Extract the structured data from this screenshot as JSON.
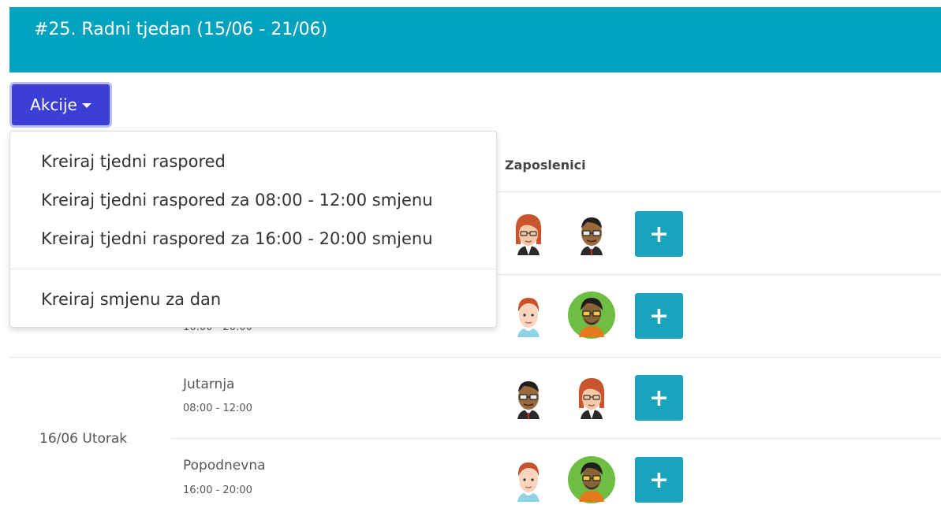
{
  "header": {
    "title": "#25. Radni tjedan (15/06 - 21/06)"
  },
  "actions": {
    "label": "Akcije"
  },
  "dropdown": {
    "items": [
      "Kreiraj tjedni raspored",
      "Kreiraj tjedni raspored za 08:00 - 12:00 smjenu",
      "Kreiraj tjedni raspored za 16:00 - 20:00 smjenu",
      "Kreiraj smjenu za dan"
    ]
  },
  "table": {
    "employees_header": "Zaposlenici",
    "add_symbol": "+",
    "partial_time": "16:00 - 20:00",
    "days": [
      {
        "label": "16/06 Utorak",
        "shifts": [
          {
            "name": "Jutarnja",
            "time": "08:00 - 12:00"
          },
          {
            "name": "Popodnevna",
            "time": "16:00 - 20:00"
          }
        ]
      }
    ]
  },
  "colors": {
    "header_bg": "#00a2bd",
    "action_btn": "#3b3fd8",
    "add_btn": "#1aa3bd"
  }
}
